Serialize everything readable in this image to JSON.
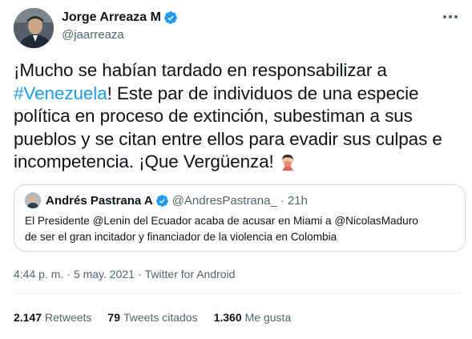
{
  "author": {
    "name": "Jorge Arreaza M",
    "handle": "@jaarreaza",
    "verified_icon": "verified-badge-icon"
  },
  "tweet": {
    "lines": [
      {
        "before": "¡Mucho se habían tardado en responsabilizar a",
        "hashtag": "",
        "after": ""
      },
      {
        "before": "",
        "hashtag": "#Venezuela",
        "after": "! Este par de individuos de una especie"
      },
      {
        "before": "política en proceso de extinción, subestiman a sus",
        "hashtag": "",
        "after": ""
      },
      {
        "before": "pueblos y se citan entre ellos para evadir sus culpas e",
        "hashtag": "",
        "after": ""
      },
      {
        "before": "incompetencia. ¡Que Vergüenza!",
        "hashtag": "",
        "after": ""
      }
    ],
    "emoji": "face-palm-emoji"
  },
  "quote": {
    "name": "Andrés Pastrana A",
    "handle": "@AndresPastrana_",
    "separator": "·",
    "time": "21h",
    "lines": [
      "El Presidente @Lenin del Ecuador acaba de acusar en Miami a @NicolasMaduro",
      "de ser el gran incitador y financiador de la violencia en Colombia"
    ]
  },
  "meta": {
    "time": "4:44 p. m.",
    "separator": "·",
    "date": "5 may. 2021",
    "source": "Twitter for Android"
  },
  "stats": {
    "retweets_count": "2.147",
    "retweets_label": "Retweets",
    "quotes_count": "79",
    "quotes_label": "Tweets citados",
    "likes_count": "1.360",
    "likes_label": "Me gusta"
  },
  "colors": {
    "accent": "#1d9bf0",
    "text": "#0f1419",
    "secondary": "#536471",
    "border": "#cfd9de"
  }
}
